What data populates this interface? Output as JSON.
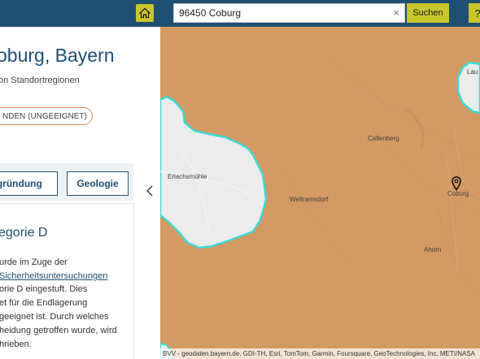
{
  "header": {
    "search_value": "96450 Coburg",
    "search_button": "Suchen",
    "help_label": "?"
  },
  "panel": {
    "title": "oburg, Bayern",
    "subtitle": "on Standortregionen",
    "badge": "NDEN (UNGEEIGNET)",
    "tabs": [
      "egründung",
      "Geologie"
    ],
    "category_title": "egorie D",
    "body_lines": [
      "urde im Zuge der",
      "Sicherheitsuntersuchungen",
      "orie D eingestuft. Dies",
      "et für die Endlagerung",
      "geeignet ist. Durch welches",
      "heidung getroffen wurde, wird",
      "hrieben."
    ],
    "collapse_icon": "chevron-left-icon"
  },
  "map": {
    "labels": {
      "erlachsmuehle": "Erlachsmühle",
      "weitramsdorf": "Weitramsdorf",
      "callenberg": "Callenberg",
      "coburg": "Coburg",
      "ahorn": "Ahorn",
      "lautertal": "Lau"
    },
    "attribution": "BVV - geodaten.bayern.de, GDI-TH, Esri, TomTom, Garmin, Foursquare, GeoTechnologies, Inc, METI/NASA",
    "colors": {
      "unsuitable_area": "#d49a63",
      "excluded_area": "#ececec",
      "boundary": "#3dd9d6",
      "accent": "#c9c62c",
      "header": "#1f4f72"
    }
  }
}
